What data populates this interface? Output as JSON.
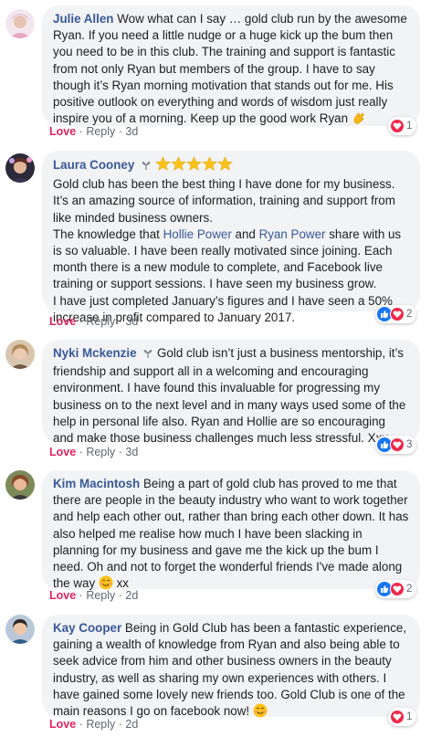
{
  "comments": [
    {
      "author": "Julie Allen",
      "text": "Wow what can I say … gold club run by the awesome Ryan. If you need a little nudge or a huge kick up the bum then you need to be in this club. The training and support is fantastic from not only Ryan but members of the group. I have to say though it’s Ryan morning motivation that stands out for me. His positive outlook on everything and words of wisdom just really inspire you of a morning. Keep up the good work Ryan",
      "emoji": "clapping-hands-emoji",
      "love": "Love",
      "reply": "Reply",
      "time": "3d",
      "reaction_count": "1",
      "reactions": [
        "love"
      ]
    },
    {
      "author": "Laura Cooney",
      "stars": 5,
      "text_part1": "Gold club has been the best thing I have done for my business. It’s an amazing source of information, training and support from like minded business owners.\nThe knowledge that ",
      "mention1": "Hollie Power",
      "text_and": " and ",
      "mention2": "Ryan Power",
      "text_part2": " share with us is so valuable. I have been really motivated since joining. Each month there is a new module to complete, and Facebook live training or support sessions. I have seen my business grow.\nI have just completed January’s figures and I have seen a 50% increase in profit compared to January 2017.",
      "love": "Love",
      "reply": "Reply",
      "time": "3d",
      "reaction_count": "2",
      "reactions": [
        "like",
        "love"
      ]
    },
    {
      "author": "Nyki Mckenzie",
      "text": "Gold club isn’t just a business mentorship, it’s friendship and support all in a welcoming and encouraging environment. I have found this invaluable for progressing my business on to the next level and in many ways used some of the help in personal life also. Ryan and Hollie are so encouraging and make those business challenges much less stressful. Xxx",
      "love": "Love",
      "reply": "Reply",
      "time": "3d",
      "reaction_count": "3",
      "reactions": [
        "like",
        "love"
      ]
    },
    {
      "author": "Kim Macintosh",
      "text": "Being a part of gold club has proved to me that there are people in the beauty industry who want to work together and help each other out, rather than bring each other down. It has also helped me realise how much I have been slacking in planning for my business and gave me the kick up the bum I need. Oh and not to forget the wonderful friends I've made along the way",
      "text_end": " xx",
      "love": "Love",
      "reply": "Reply",
      "time": "2d",
      "reaction_count": "2",
      "reactions": [
        "like",
        "love"
      ]
    },
    {
      "author": "Kay Cooper",
      "text": "Being in Gold Club has been a fantastic experience, gaining a wealth of knowledge from Ryan and also being able to seek advice from him and other business owners in the beauty industry, as well as sharing my own experiences with others. I have gained some lovely new friends too. Gold Club is one of the main reasons I go on facebook now!",
      "love": "Love",
      "reply": "Reply",
      "time": "2d",
      "reaction_count": "1",
      "reactions": [
        "love"
      ]
    }
  ],
  "separator": "·",
  "colors": {
    "author": "#385898",
    "bubble": "#f2f3f5",
    "love": "#e0245e",
    "like": "#1877f2",
    "heart": "#f0284a",
    "muted": "#606770"
  }
}
